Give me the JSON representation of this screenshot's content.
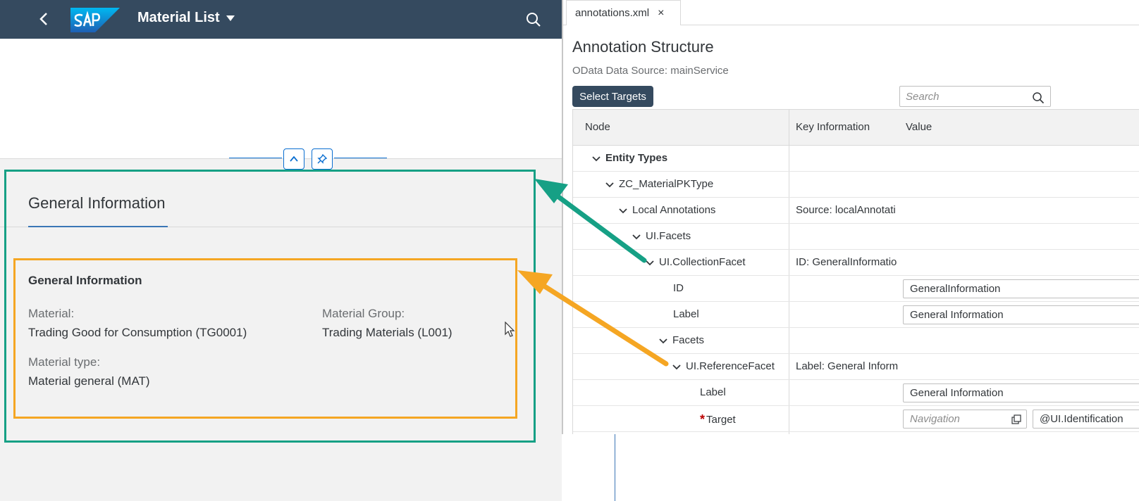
{
  "shell": {
    "title": "Material List"
  },
  "object_page": {
    "section_title": "General Information",
    "subsection_title": "General Information",
    "fields": [
      {
        "label": "Material:",
        "value": "Trading Good for Consumption (TG0001)"
      },
      {
        "label": "Material Group:",
        "value": "Trading Materials (L001)"
      },
      {
        "label": "Material type:",
        "value": "Material general (MAT)"
      }
    ]
  },
  "editor": {
    "tab_label": "annotations.xml",
    "tab_close": "×",
    "title": "Annotation Structure",
    "datasource": "OData Data Source: mainService",
    "select_targets": "Select Targets",
    "search_placeholder": "Search",
    "columns": [
      "Node",
      "Key Information",
      "Value"
    ],
    "rows": [
      {
        "node": "Entity Types",
        "key": "",
        "value": ""
      },
      {
        "node": "ZC_MaterialPKType",
        "key": "",
        "value": ""
      },
      {
        "node": "Local Annotations",
        "key": "Source: localAnnotati",
        "value": ""
      },
      {
        "node": "UI.Facets",
        "key": "",
        "value": ""
      },
      {
        "node": "UI.CollectionFacet",
        "key": "ID: GeneralInformatio",
        "value": ""
      },
      {
        "node": "ID",
        "key": "",
        "value": "GeneralInformation"
      },
      {
        "node": "Label",
        "key": "",
        "value": "General Information"
      },
      {
        "node": "Facets",
        "key": "",
        "value": ""
      },
      {
        "node": "UI.ReferenceFacet",
        "key": "Label: General Inform",
        "value": ""
      },
      {
        "node": "Label",
        "key": "",
        "value": "General Information"
      },
      {
        "node": "Target",
        "required_mark": "*",
        "key": "",
        "nav_placeholder": "Navigation",
        "value": "@UI.Identification"
      }
    ]
  },
  "colors": {
    "shell": "#354a5f",
    "green_highlight": "#16a085",
    "orange_highlight": "#f5a623",
    "accent": "#0a6ed1"
  }
}
